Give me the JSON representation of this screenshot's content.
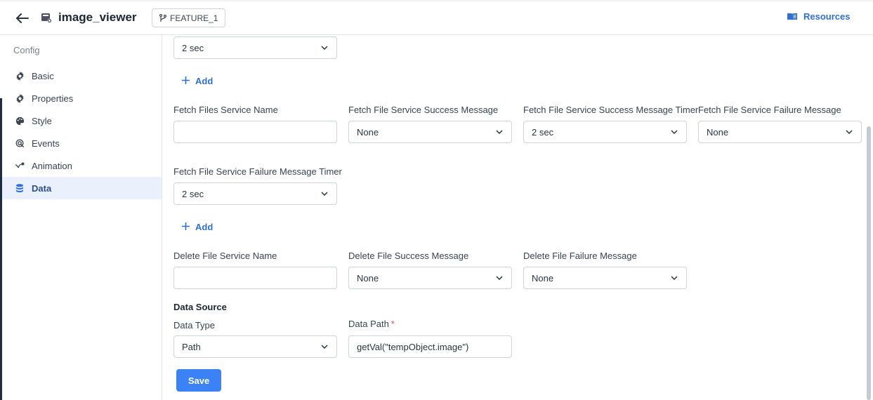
{
  "header": {
    "title": "image_viewer",
    "branch": "FEATURE_1",
    "resources_label": "Resources"
  },
  "sidebar": {
    "section_title": "Config",
    "items": [
      {
        "label": "Basic",
        "icon": "gear-icon"
      },
      {
        "label": "Properties",
        "icon": "gear-icon"
      },
      {
        "label": "Style",
        "icon": "palette-icon"
      },
      {
        "label": "Events",
        "icon": "events-icon"
      },
      {
        "label": "Animation",
        "icon": "animation-icon"
      },
      {
        "label": "Data",
        "icon": "database-icon",
        "active": true
      }
    ]
  },
  "main": {
    "top_timer": {
      "value": "2 sec"
    },
    "add_label": "Add",
    "fetch": {
      "service_name_label": "Fetch Files Service Name",
      "service_name_value": "",
      "success_msg_label": "Fetch File Service Success Message",
      "success_msg_value": "None",
      "success_timer_label": "Fetch File Service Success Message Timer",
      "success_timer_value": "2 sec",
      "failure_msg_label": "Fetch File Service Failure Message",
      "failure_msg_value": "None",
      "failure_timer_label": "Fetch File Service Failure Message Timer",
      "failure_timer_value": "2 sec"
    },
    "delete": {
      "service_name_label": "Delete File Service Name",
      "service_name_value": "",
      "success_msg_label": "Delete File Success Message",
      "success_msg_value": "None",
      "failure_msg_label": "Delete File Failure Message",
      "failure_msg_value": "None"
    },
    "data_source": {
      "heading": "Data Source",
      "type_label": "Data Type",
      "type_value": "Path",
      "path_label": "Data Path",
      "required_mark": "*",
      "path_value": "getVal(\"tempObject.image\")"
    },
    "save_label": "Save"
  },
  "colors": {
    "accent": "#2f6fd6",
    "primary_button": "#3b82f6",
    "active_bg": "#eaf1fd",
    "required": "#d9534f"
  }
}
